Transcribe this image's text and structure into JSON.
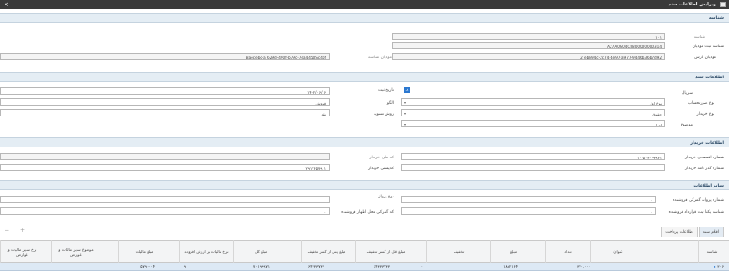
{
  "window": {
    "title": "ویرایش اطلاعات سند",
    "close_glyph": "×"
  },
  "section_identity": {
    "title": "شناسه",
    "serial_label": "شناسه",
    "serial_value": "۱۰۱",
    "tax_id_label": "شناسه ثبت موديان",
    "tax_id_value": "A27A0G04C8800000000314",
    "taxpayer_label": "موديان پارس",
    "taxpayer_value": "2 ebb94c-2c74-4e97-a977-9446b36b7d92",
    "taxpayer_id_label": "موديان شناسه",
    "taxpayer_id_value": "Baecebc-a 629d-490f-b79c-7ea4450Sc4bf"
  },
  "section_document": {
    "title": "اطلاعات سند",
    "serial_label": "سريال",
    "serial_value": "۸۸",
    "date_label": "تاريخ ثبت",
    "date_value": "۱۴۰۲/۰۶/۰۶",
    "pattern_label": "نوع صورتحساب",
    "pattern_value": "نوع اول",
    "template_label": "الگو",
    "template_value": "فروش",
    "buyer_type_label": "نوع خريدار",
    "buyer_type_value": "حقوق",
    "settlement_label": "روش تسويه",
    "settlement_value": "نقد",
    "subject_label": "موضوع",
    "subject_value": "اصلی"
  },
  "section_buyer": {
    "title": "اطلاعات خريدار",
    "economic_label": "شماره اقتصادی خريدار",
    "economic_value": "۱۰۶۵۰۳۰۳۹۹۶۱",
    "national_label": "كد ملی خريدار",
    "customs_label": "شماره گذر نامه خريدار",
    "postal_label": "كدپستی خريدار",
    "postal_value": "۲۹۱۷۶۵۷۹۱۱"
  },
  "section_other": {
    "title": "ساير اطلاعات",
    "license_label": "شماره پروانه گمركی فروشنده",
    "license_value": "۰",
    "registry_label": "شناسه يكتا ثبت قرارداد فروشنده",
    "registry_value": "۰",
    "customs_code_label": "كد گمركی محل اظهار فروشنده",
    "flight_label": "نوع پرواز",
    "customs_code_value": "۰"
  },
  "tabs": [
    {
      "label": "اقلام سند"
    },
    {
      "label": "اطلاعات پرداخت"
    }
  ],
  "table": {
    "headers": [
      "شناسه",
      "عنوان",
      "تعداد",
      "مبلغ",
      "تخفيف",
      "مبلغ قبل از كسر تخفيف",
      "مبلغ پس از كسر تخفيف",
      "مبلغ كل",
      "نرخ ماليات بر ارزش افزوده",
      "مبلغ ماليات",
      "موضوع ساير ماليات و عوارض",
      "نرخ ساير ماليات و عوارض"
    ],
    "row": {
      "id": "۳۰۶",
      "title": "",
      "qty": "۳۳۰,۰۰۰",
      "price": "۱۸۹۲۱۶۴",
      "discount": "۰",
      "before": "۶۴۳۳۳۷۳۳",
      "after": "۶۴۳۳۳۷۳۳",
      "total": "۷۰۱۹۶۹۷۱",
      "vat_rate": "۹",
      "vat": "۵۷۹۰۰۰۴",
      "other_subject": "",
      "other_rate": ""
    }
  },
  "colors": {
    "section_bg": "#e4edf4",
    "row_bg": "#dde9f5",
    "accent": "#2b78d0"
  },
  "icons": {
    "add": "+",
    "remove": "−",
    "row_arrow": "◂"
  }
}
